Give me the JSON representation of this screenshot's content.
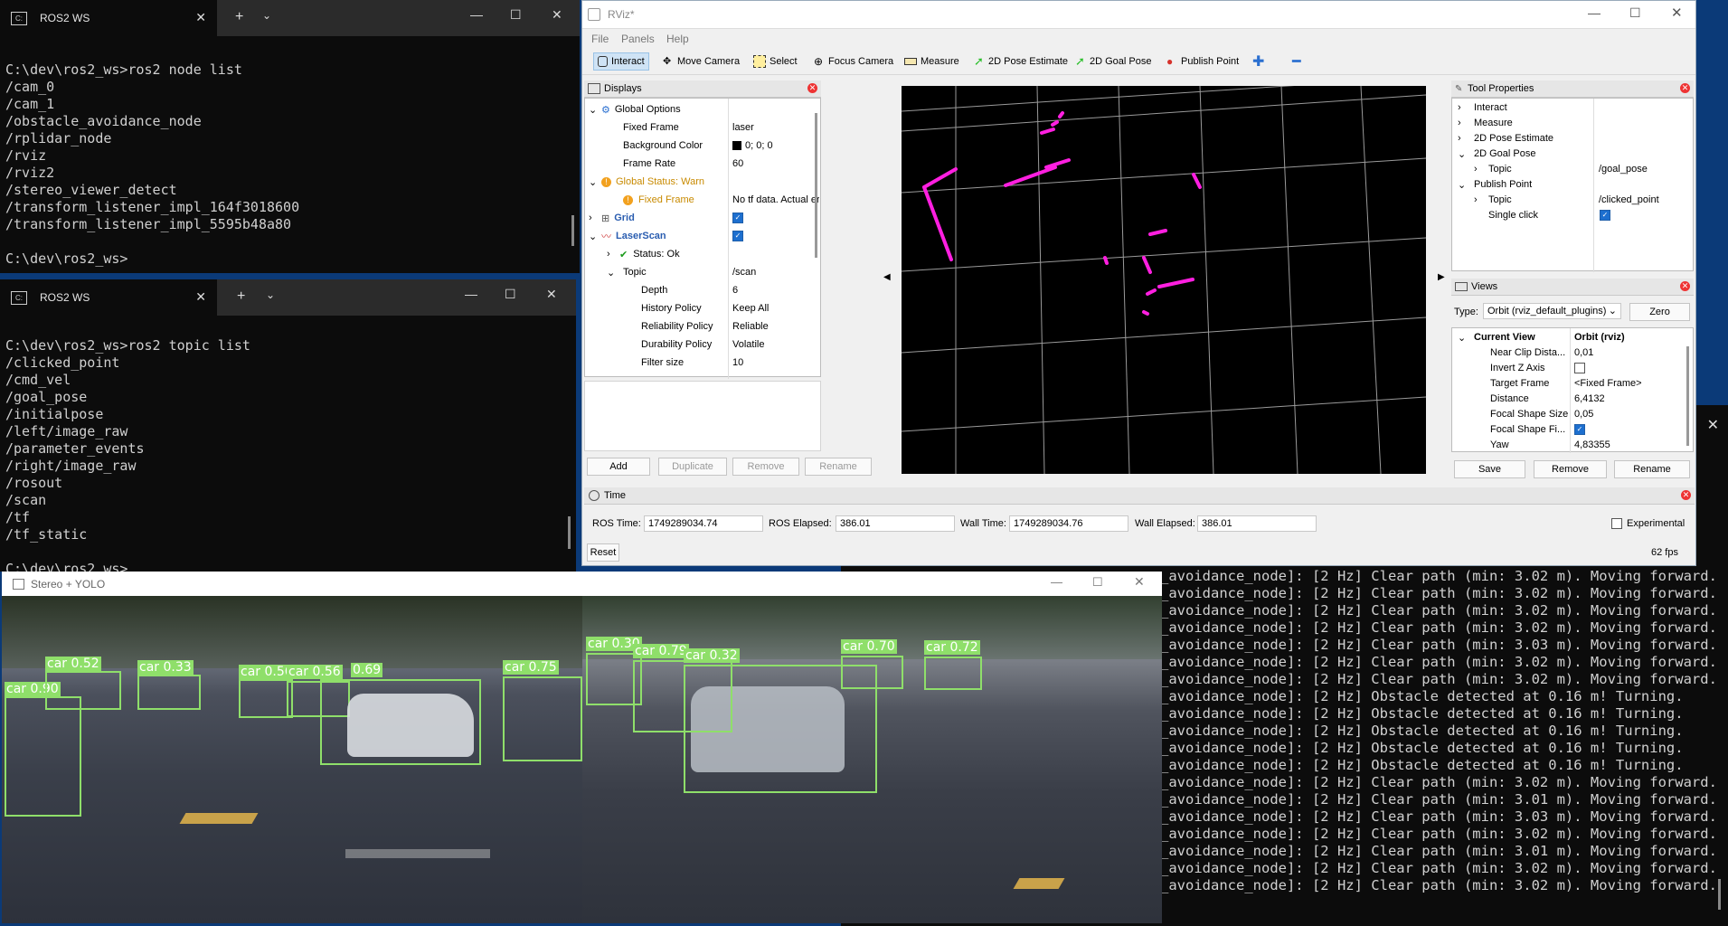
{
  "term1": {
    "tab_title": "ROS2 WS",
    "lines": [
      "",
      "C:\\dev\\ros2_ws>ros2 node list",
      "/cam_0",
      "/cam_1",
      "/obstacle_avoidance_node",
      "/rplidar_node",
      "/rviz",
      "/rviz2",
      "/stereo_viewer_detect",
      "/transform_listener_impl_164f3018600",
      "/transform_listener_impl_5595b48a80",
      "",
      "C:\\dev\\ros2_ws>"
    ]
  },
  "term2": {
    "tab_title": "ROS2 WS",
    "lines": [
      "",
      "C:\\dev\\ros2_ws>ros2 topic list",
      "/clicked_point",
      "/cmd_vel",
      "/goal_pose",
      "/initialpose",
      "/left/image_raw",
      "/parameter_events",
      "/right/image_raw",
      "/rosout",
      "/scan",
      "/tf",
      "/tf_static",
      "",
      "C:\\dev\\ros2_ws>"
    ]
  },
  "rviz": {
    "title": "RViz*",
    "menu": [
      "File",
      "Panels",
      "Help"
    ],
    "tools": [
      "Interact",
      "Move Camera",
      "Select",
      "Focus Camera",
      "Measure",
      "2D Pose Estimate",
      "2D Goal Pose",
      "Publish Point"
    ],
    "displays": {
      "title": "Displays",
      "global_options": "Global Options",
      "fixed_frame_label": "Fixed Frame",
      "fixed_frame_value": "laser",
      "bg_color_label": "Background Color",
      "bg_color_value": "0; 0; 0",
      "frame_rate_label": "Frame Rate",
      "frame_rate_value": "60",
      "global_status": "Global Status: Warn",
      "fixed_frame_warn": "Fixed Frame",
      "fixed_frame_warn_value": "No tf data.  Actual error: Fr",
      "grid": "Grid",
      "laserscan": "LaserScan",
      "status_ok": "Status: Ok",
      "topic_label": "Topic",
      "topic_value": "/scan",
      "depth_label": "Depth",
      "depth_value": "6",
      "history_label": "History Policy",
      "history_value": "Keep All",
      "reliability_label": "Reliability Policy",
      "reliability_value": "Reliable",
      "durability_label": "Durability Policy",
      "durability_value": "Volatile",
      "filter_label": "Filter size",
      "filter_value": "10",
      "buttons": [
        "Add",
        "Duplicate",
        "Remove",
        "Rename"
      ]
    },
    "tool_props": {
      "title": "Tool Properties",
      "interact": "Interact",
      "measure": "Measure",
      "pose_estimate": "2D Pose Estimate",
      "goal_pose": "2D Goal Pose",
      "topic_label": "Topic",
      "goal_topic": "/goal_pose",
      "publish_point": "Publish Point",
      "publish_topic": "/clicked_point",
      "single_click": "Single click"
    },
    "views": {
      "title": "Views",
      "type_label": "Type:",
      "type_value": "Orbit (rviz_default_plugins)",
      "zero": "Zero",
      "current_view": "Current View",
      "current_view_value": "Orbit (rviz)",
      "near_clip": "Near Clip Dista...",
      "near_clip_value": "0,01",
      "invert_z": "Invert Z Axis",
      "target_frame": "Target Frame",
      "target_frame_value": "<Fixed Frame>",
      "distance": "Distance",
      "distance_value": "6,4132",
      "focal_size": "Focal Shape Size",
      "focal_size_value": "0,05",
      "focal_fixed": "Focal Shape Fi...",
      "yaw": "Yaw",
      "yaw_value": "4,83355",
      "buttons": [
        "Save",
        "Remove",
        "Rename"
      ]
    },
    "time": {
      "title": "Time",
      "ros_time_label": "ROS Time:",
      "ros_time": "1749289034.74",
      "ros_elapsed_label": "ROS Elapsed:",
      "ros_elapsed": "386.01",
      "wall_time_label": "Wall Time:",
      "wall_time": "1749289034.76",
      "wall_elapsed_label": "Wall Elapsed:",
      "wall_elapsed": "386.01",
      "experimental": "Experimental",
      "reset": "Reset",
      "fps": "62 fps"
    }
  },
  "log": {
    "lines": [
      "_avoidance_node]: [2 Hz] Clear path (min: 3.02 m). Moving forward.",
      "_avoidance_node]: [2 Hz] Clear path (min: 3.02 m). Moving forward.",
      "_avoidance_node]: [2 Hz] Clear path (min: 3.02 m). Moving forward.",
      "_avoidance_node]: [2 Hz] Clear path (min: 3.02 m). Moving forward.",
      "_avoidance_node]: [2 Hz] Clear path (min: 3.03 m). Moving forward.",
      "_avoidance_node]: [2 Hz] Clear path (min: 3.02 m). Moving forward.",
      "_avoidance_node]: [2 Hz] Clear path (min: 3.02 m). Moving forward.",
      "_avoidance_node]: [2 Hz] Obstacle detected at 0.16 m! Turning.",
      "_avoidance_node]: [2 Hz] Obstacle detected at 0.16 m! Turning.",
      "_avoidance_node]: [2 Hz] Obstacle detected at 0.16 m! Turning.",
      "_avoidance_node]: [2 Hz] Obstacle detected at 0.16 m! Turning.",
      "_avoidance_node]: [2 Hz] Obstacle detected at 0.16 m! Turning.",
      "_avoidance_node]: [2 Hz] Clear path (min: 3.02 m). Moving forward.",
      "_avoidance_node]: [2 Hz] Clear path (min: 3.01 m). Moving forward.",
      "_avoidance_node]: [2 Hz] Clear path (min: 3.03 m). Moving forward.",
      "_avoidance_node]: [2 Hz] Clear path (min: 3.02 m). Moving forward.",
      "_avoidance_node]: [2 Hz] Clear path (min: 3.01 m). Moving forward.",
      "_avoidance_node]: [2 Hz] Clear path (min: 3.02 m). Moving forward.",
      "_avoidance_node]: [2 Hz] Clear path (min: 3.02 m). Moving forward."
    ]
  },
  "yolo": {
    "title": "Stereo + YOLO",
    "detections_left": [
      "car 0.90",
      "car 0.52",
      "car 0.33",
      "car 0.56",
      "car 0.56",
      "0.69",
      "car 0.75"
    ],
    "detections_right": [
      "car 0.30",
      "car 0.79",
      "car 0.32",
      "car 0.70",
      "car 0.72"
    ]
  }
}
